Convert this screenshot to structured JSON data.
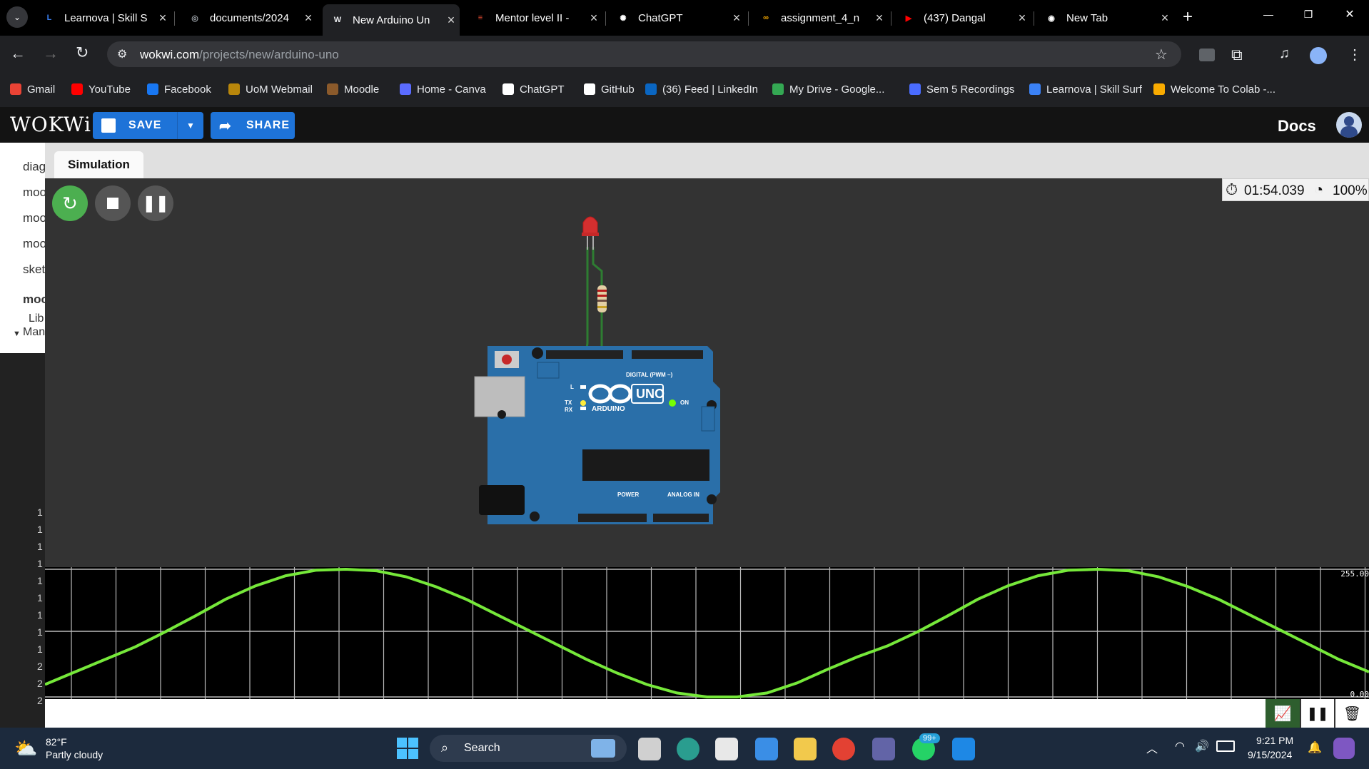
{
  "browser": {
    "tabs": [
      {
        "label": "Learnova | Skill S",
        "icon_color": "#3b82f6",
        "icon": "L"
      },
      {
        "label": "documents/2024",
        "icon_color": "#9aa0a6",
        "icon": "◎"
      },
      {
        "label": "New Arduino Un",
        "icon_color": "#e8eaed",
        "icon": "W"
      },
      {
        "label": "Mentor level II -",
        "icon_color": "#e04a2f",
        "icon": "≡"
      },
      {
        "label": "ChatGPT",
        "icon_color": "#ffffff",
        "icon": "✺"
      },
      {
        "label": "assignment_4_n",
        "icon_color": "#f9ab00",
        "icon": "∞"
      },
      {
        "label": "(437) Dangal",
        "icon_color": "#ff0000",
        "icon": "▶"
      },
      {
        "label": "New Tab",
        "icon_color": "#ffffff",
        "icon": "◉"
      }
    ],
    "new_tab": "+",
    "window_controls": {
      "minimize": "—",
      "restore": "❐",
      "close": "✕"
    },
    "url_domain": "wokwi.com",
    "url_path": "/projects/new/arduino-uno",
    "bookmarks": [
      {
        "label": "Gmail",
        "color": "#ea4335"
      },
      {
        "label": "YouTube",
        "color": "#ff0000"
      },
      {
        "label": "Facebook",
        "color": "#1877f2"
      },
      {
        "label": "UoM Webmail",
        "color": "#b8860b"
      },
      {
        "label": "Moodle",
        "color": "#8b5a2b"
      },
      {
        "label": "Home - Canva",
        "color": "#5a6bff"
      },
      {
        "label": "ChatGPT",
        "color": "#ffffff"
      },
      {
        "label": "GitHub",
        "color": "#ffffff"
      },
      {
        "label": "(36) Feed | LinkedIn",
        "color": "#0a66c2"
      },
      {
        "label": "My Drive - Google...",
        "color": "#34a853"
      },
      {
        "label": "Sem 5 Recordings",
        "color": "#4a6cff"
      },
      {
        "label": "Learnova | Skill Surf",
        "color": "#3b82f6"
      },
      {
        "label": "Welcome To Colab -...",
        "color": "#f9ab00"
      }
    ]
  },
  "wokwi": {
    "logo": "WOKWi",
    "save_label": "SAVE",
    "share_label": "SHARE",
    "docs_label": "Docs",
    "active_tab": "Simulation",
    "side_files": [
      "diag",
      "moo",
      "moo",
      "moo",
      "sket",
      "moo"
    ],
    "library_label_1": "Lib",
    "library_label_2": "Man",
    "sim_time": "01:54.039",
    "sim_speed": "100%",
    "board_labels": {
      "uno": "UNO",
      "arduino": "ARDUINO",
      "digital": "DIGITAL (PWM ~)",
      "on": "ON",
      "tx": "TX",
      "rx": "RX",
      "l": "L",
      "power": "POWER",
      "analog_in": "ANALOG IN"
    },
    "plotter": {
      "y_max_label": "255.00",
      "y_min_label": "0.00",
      "left_ticks": [
        "1",
        "1",
        "1",
        "1",
        "1",
        "1",
        "1",
        "1",
        "1",
        "2",
        "2",
        "2"
      ]
    }
  },
  "chart_data": {
    "type": "line",
    "title": "",
    "ylim": [
      0,
      255
    ],
    "series": [
      {
        "values": [
          25,
          50,
          75,
          100,
          130,
          162,
          195,
          222,
          242,
          253,
          255,
          252,
          240,
          220,
          195,
          165,
          135,
          105,
          75,
          48,
          25,
          8,
          0,
          0,
          8,
          28,
          55,
          80,
          102,
          130,
          162,
          195,
          222,
          242,
          253,
          255,
          252,
          240,
          220,
          195,
          165,
          135,
          105,
          75,
          50
        ]
      }
    ]
  },
  "taskbar": {
    "weather_temp": "82°F",
    "weather_desc": "Partly cloudy",
    "search_label": "Search",
    "time": "9:21 PM",
    "date": "9/15/2024",
    "whatsapp_badge": "99+"
  }
}
